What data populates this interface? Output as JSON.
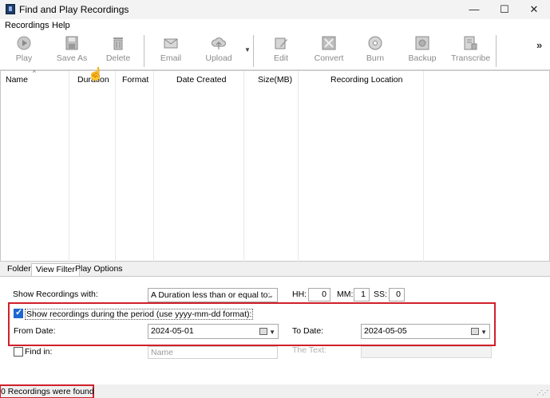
{
  "window": {
    "title": "Find and Play Recordings",
    "minimize": "—",
    "maximize": "☐",
    "close": "✕"
  },
  "menu": {
    "recordings": "Recordings",
    "help": "Help"
  },
  "toolbar": {
    "play": "Play",
    "save_as": "Save As",
    "delete": "Delete",
    "email": "Email",
    "upload": "Upload",
    "edit": "Edit",
    "convert": "Convert",
    "burn": "Burn",
    "backup": "Backup",
    "transcribe": "Transcribe",
    "more": "»",
    "upload_dropdown": "▼"
  },
  "columns": [
    "Name",
    "Duration",
    "Format",
    "Date Created",
    "Size(MB)",
    "Recording Location"
  ],
  "tabs": [
    "Folder",
    "View Filter",
    "Play Options"
  ],
  "filter": {
    "show_with_label": "Show Recordings with:",
    "duration_option": "A Duration less than or equal to:",
    "hh_label": "HH:",
    "hh_value": "0",
    "mm_label": "MM:",
    "mm_value": "1",
    "ss_label": "SS:",
    "ss_value": "0",
    "period_checkbox_label": "Show recordings during the period (use yyyy-mm-dd format):",
    "period_checked": true,
    "from_label": "From Date:",
    "from_value": "2024-05-01",
    "to_label": "To Date:",
    "to_value": "2024-05-05",
    "find_in_label": "Find in:",
    "find_in_checked": false,
    "find_in_option": "Name",
    "the_text_label": "The Text:"
  },
  "status": {
    "text": "0 Recordings were found"
  },
  "colors": {
    "highlight_red": "#d0202a",
    "checkbox_blue": "#1e66d0"
  }
}
